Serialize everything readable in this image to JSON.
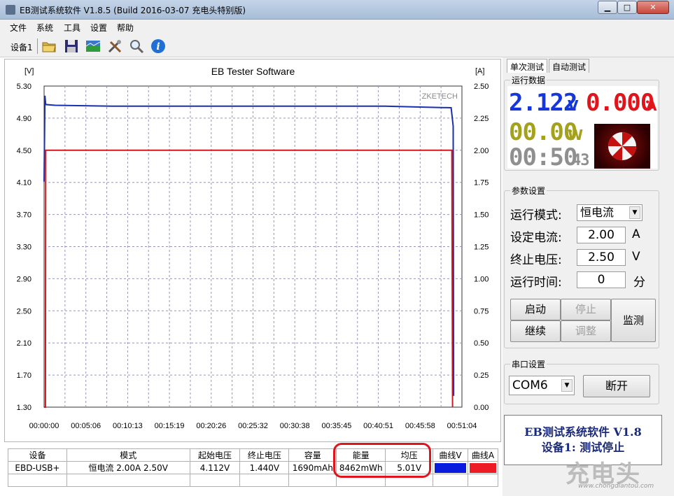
{
  "window": {
    "title": "EB测试系统软件 V1.8.5 (Build 2016-03-07 充电头特别版)",
    "min_glyph": "▁",
    "max_glyph": "□",
    "close_glyph": "✕"
  },
  "menu": {
    "items": [
      "文件",
      "系统",
      "工具",
      "设置",
      "帮助"
    ]
  },
  "toolbar": {
    "device_label": "设备1",
    "icons": [
      "folder-icon",
      "save-icon",
      "chart-icon",
      "tools-icon",
      "search-icon",
      "info-icon"
    ]
  },
  "chart_data": {
    "type": "line",
    "title": "EB Tester Software",
    "y_left_label": "[V]",
    "y_right_label": "[A]",
    "brand": "ZKETECH",
    "y_left_ticks": [
      "5.30",
      "4.90",
      "4.50",
      "4.10",
      "3.70",
      "3.30",
      "2.90",
      "2.50",
      "2.10",
      "1.70",
      "1.30"
    ],
    "y_right_ticks": [
      "2.50",
      "2.25",
      "2.00",
      "1.75",
      "1.50",
      "1.25",
      "1.00",
      "0.75",
      "0.50",
      "0.25",
      "0.00"
    ],
    "x_ticks": [
      "00:00:00",
      "00:05:06",
      "00:10:13",
      "00:15:19",
      "00:20:26",
      "00:25:32",
      "00:30:38",
      "00:35:45",
      "00:40:51",
      "00:45:58",
      "00:51:04"
    ],
    "y_left_range": [
      1.3,
      5.3
    ],
    "y_right_range": [
      0.0,
      2.5
    ],
    "x_range_sec": [
      0,
      3064
    ],
    "grid": true,
    "series": [
      {
        "axis": "left",
        "color": "#1a2fb0",
        "points": [
          [
            0,
            4.11
          ],
          [
            6,
            5.18
          ],
          [
            12,
            5.07
          ],
          [
            80,
            5.06
          ],
          [
            500,
            5.05
          ],
          [
            1000,
            5.05
          ],
          [
            1500,
            5.05
          ],
          [
            2000,
            5.05
          ],
          [
            2500,
            5.05
          ],
          [
            2700,
            5.04
          ],
          [
            2985,
            5.03
          ],
          [
            3000,
            4.8
          ],
          [
            3003,
            1.44
          ]
        ]
      },
      {
        "axis": "right",
        "color": "#d0191f",
        "points": [
          [
            0,
            0.0
          ],
          [
            10,
            0.0
          ],
          [
            12,
            2.0
          ],
          [
            1000,
            2.0
          ],
          [
            2000,
            2.0
          ],
          [
            2990,
            2.0
          ],
          [
            2995,
            0.0
          ]
        ]
      }
    ]
  },
  "table": {
    "headers": [
      "设备",
      "模式",
      "起始电压",
      "终止电压",
      "容量",
      "能量",
      "均压",
      "曲线V",
      "曲线A"
    ],
    "rows": [
      {
        "device": "EBD-USB+",
        "mode": "恒电流  2.00A  2.50V",
        "start_v": "4.112V",
        "end_v": "1.440V",
        "capacity": "1690mAh",
        "energy": "8462mWh",
        "avg_v": "5.01V",
        "curve_v_color": "#0a1be0",
        "curve_a_color": "#ec1b24"
      }
    ]
  },
  "tabs": [
    "单次测试",
    "自动测试"
  ],
  "running": {
    "group_title": "运行数据",
    "voltage": "2.122",
    "voltage_unit": "V",
    "current": "0.000",
    "current_unit": "A",
    "power": "00.00",
    "power_unit": "W",
    "time_main": "00:50",
    "time_sec": "43"
  },
  "params": {
    "group_title": "参数设置",
    "mode_label": "运行模式:",
    "mode_value": "恒电流",
    "current_label": "设定电流:",
    "current_value": "2.00",
    "current_unit": "A",
    "cutoff_label": "终止电压:",
    "cutoff_value": "2.50",
    "cutoff_unit": "V",
    "runtime_label": "运行时间:",
    "runtime_value": "0",
    "runtime_unit": "分"
  },
  "buttons": {
    "start": "启动",
    "stop": "停止",
    "continue": "继续",
    "adjust": "调整",
    "monitor": "监测"
  },
  "serial": {
    "group_title": "串口设置",
    "port": "COM6",
    "disconnect": "断开"
  },
  "status": {
    "line1": "EB测试系统软件 V1.8",
    "line2": "设备1: 测试停止"
  },
  "watermark": {
    "text": "充电头",
    "url": "www.chongdiantou.com"
  }
}
